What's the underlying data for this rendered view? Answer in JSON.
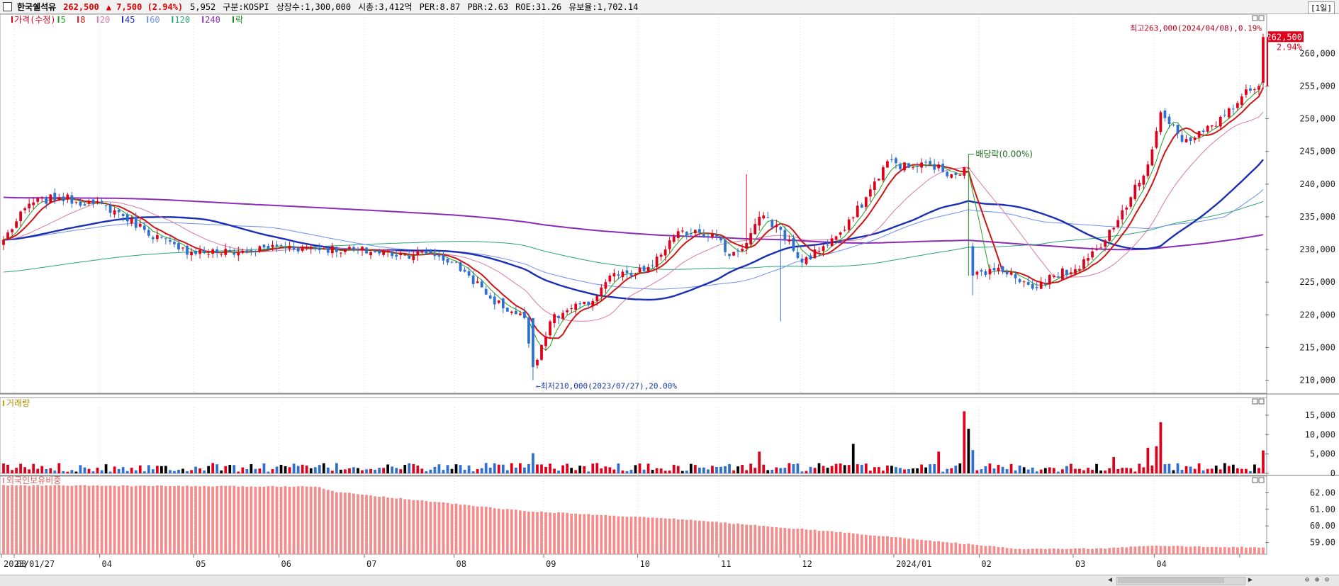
{
  "header": {
    "name": "한국쉘석유",
    "price": "262,500",
    "change": "▲ 7,500 (2.94%)",
    "volume": "5,952",
    "market": "구분:KOSPI",
    "shares": "상장수:1,300,000",
    "mcap": "시총:3,412억",
    "per": "PER:8.87",
    "pbr": "PBR:2.63",
    "roe": "ROE:31.26",
    "float": "유보율:1,702.14",
    "period": "[1일]"
  },
  "colors": {
    "up": "#e0001a",
    "down": "#2e6fcf",
    "ma5": "#22a022",
    "ma8": "#d21414",
    "ma20": "#d77aa8",
    "ma45": "#1b2fb5",
    "ma60": "#6f8ff0",
    "ma120": "#2aa37a",
    "ma240": "#8a2cb8",
    "foreign": "#f48c8c",
    "grid": "#d9d9d9"
  },
  "chart_data": [
    {
      "type": "candlestick",
      "title": "가격(수정)",
      "legend": [
        "가격(수정)",
        "5",
        "8",
        "20",
        "45",
        "60",
        "120",
        "240",
        "락"
      ],
      "ylim": [
        208000,
        266000
      ],
      "y_ticks": [
        "255,000",
        "250,000",
        "245,000",
        "240,000",
        "235,000",
        "230,000",
        "225,000",
        "220,000",
        "215,000",
        "210,000"
      ],
      "y_top_tick": "260,000",
      "current_price_label": "262,500",
      "current_pct_label": "2.94%",
      "x_labels": [
        "2023/01/27",
        "03",
        "04",
        "05",
        "06",
        "07",
        "08",
        "09",
        "10",
        "11",
        "12",
        "2024/01",
        "02",
        "03",
        "04"
      ],
      "keypoints": [
        [
          "2023/01/27",
          231500
        ],
        [
          "2023/02/06",
          237000
        ],
        [
          "2023/02/15",
          238000
        ],
        [
          "2023/02/27",
          237000
        ],
        [
          "2023/03/07",
          236000
        ],
        [
          "2023/03/16",
          233000
        ],
        [
          "2023/03/28",
          230000
        ],
        [
          "2023/04/10",
          229500
        ],
        [
          "2023/04/20",
          229800
        ],
        [
          "2023/05/01",
          230500
        ],
        [
          "2023/05/12",
          230200
        ],
        [
          "2023/05/24",
          230000
        ],
        [
          "2023/06/05",
          229600
        ],
        [
          "2023/06/15",
          229200
        ],
        [
          "2023/06/23",
          229500
        ],
        [
          "2023/06/30",
          228000
        ],
        [
          "2023/07/06",
          226000
        ],
        [
          "2023/07/13",
          222500
        ],
        [
          "2023/07/20",
          220500
        ],
        [
          "2023/07/25",
          219500
        ],
        [
          "2023/07/27",
          212000
        ],
        [
          "2023/08/02",
          219000
        ],
        [
          "2023/08/09",
          221000
        ],
        [
          "2023/08/16",
          221500
        ],
        [
          "2023/08/23",
          226000
        ],
        [
          "2023/08/30",
          226000
        ],
        [
          "2023/09/06",
          227500
        ],
        [
          "2023/09/13",
          232000
        ],
        [
          "2023/09/20",
          233000
        ],
        [
          "2023/09/27",
          232000
        ],
        [
          "2023/10/06",
          229000
        ],
        [
          "2023/10/13",
          231000
        ],
        [
          "2023/10/18",
          235000
        ],
        [
          "2023/10/25",
          233000
        ],
        [
          "2023/11/01",
          228000
        ],
        [
          "2023/11/08",
          230500
        ],
        [
          "2023/11/15",
          233000
        ],
        [
          "2023/11/22",
          238000
        ],
        [
          "2023/11/29",
          243500
        ],
        [
          "2023/12/06",
          242500
        ],
        [
          "2023/12/13",
          243000
        ],
        [
          "2023/12/20",
          241500
        ],
        [
          "2023/12/27",
          242500
        ],
        [
          "2023/12/28",
          226000
        ],
        [
          "2024/01/04",
          227000
        ],
        [
          "2024/01/11",
          226500
        ],
        [
          "2024/01/18",
          224000
        ],
        [
          "2024/01/25",
          226000
        ],
        [
          "2024/02/01",
          227000
        ],
        [
          "2024/02/08",
          230000
        ],
        [
          "2024/02/15",
          233000
        ],
        [
          "2024/02/22",
          238000
        ],
        [
          "2024/02/28",
          243000
        ],
        [
          "2024/03/05",
          251000
        ],
        [
          "2024/03/12",
          246500
        ],
        [
          "2024/03/19",
          248000
        ],
        [
          "2024/03/26",
          250500
        ],
        [
          "2024/04/02",
          254500
        ],
        [
          "2024/04/05",
          255000
        ],
        [
          "2024/04/08",
          262500
        ]
      ],
      "annotations": [
        {
          "text": "최고263,000(2024/04/08),0.19%",
          "date": "2024/04/08",
          "value": 263000
        },
        {
          "text": "최저210,000(2023/07/27),20.00%",
          "date": "2023/07/27",
          "value": 210000
        },
        {
          "text": "배당락(0.00%)",
          "date": "2023/12/27",
          "value": 243500
        }
      ],
      "moving_averages": [
        {
          "name": "5",
          "period": 5
        },
        {
          "name": "8",
          "period": 8
        },
        {
          "name": "20",
          "period": 20
        },
        {
          "name": "45",
          "period": 45
        },
        {
          "name": "60",
          "period": 60
        },
        {
          "name": "120",
          "period": 120,
          "start": 226500
        },
        {
          "name": "240",
          "period": 240,
          "start": 238000
        }
      ]
    },
    {
      "type": "bar",
      "title": "거래량",
      "ylim": [
        0,
        17000
      ],
      "y_ticks": [
        "15,000",
        "10,000",
        "5,000",
        "0"
      ],
      "baseline": 1200,
      "spikes": [
        [
          "2023/07/27",
          5200
        ],
        [
          "2023/10/18",
          5600
        ],
        [
          "2023/11/17",
          7600
        ],
        [
          "2023/12/15",
          5600
        ],
        [
          "2023/12/26",
          16000
        ],
        [
          "2023/12/27",
          11500
        ],
        [
          "2023/12/28",
          6000
        ],
        [
          "2024/02/16",
          4200
        ],
        [
          "2024/02/28",
          6600
        ],
        [
          "2024/03/05",
          13200
        ],
        [
          "2024/03/04",
          7000
        ],
        [
          "2024/04/08",
          5900
        ]
      ]
    },
    {
      "type": "bar",
      "title": "외국인보유비중",
      "ylim": [
        58.3,
        63.0
      ],
      "y_ticks": [
        "62.00",
        "61.00",
        "60.00",
        "59.00"
      ],
      "keypoints": [
        [
          "2023/01/27",
          62.45
        ],
        [
          "2023/04/25",
          62.38
        ],
        [
          "2023/05/15",
          62.4
        ],
        [
          "2023/05/22",
          62.05
        ],
        [
          "2023/07/25",
          60.9
        ],
        [
          "2023/09/15",
          60.4
        ],
        [
          "2023/11/15",
          59.6
        ],
        [
          "2023/12/27",
          58.9
        ],
        [
          "2024/01/15",
          58.6
        ],
        [
          "2024/02/15",
          58.65
        ],
        [
          "2024/02/28",
          58.8
        ],
        [
          "2024/04/08",
          58.7
        ]
      ]
    }
  ]
}
